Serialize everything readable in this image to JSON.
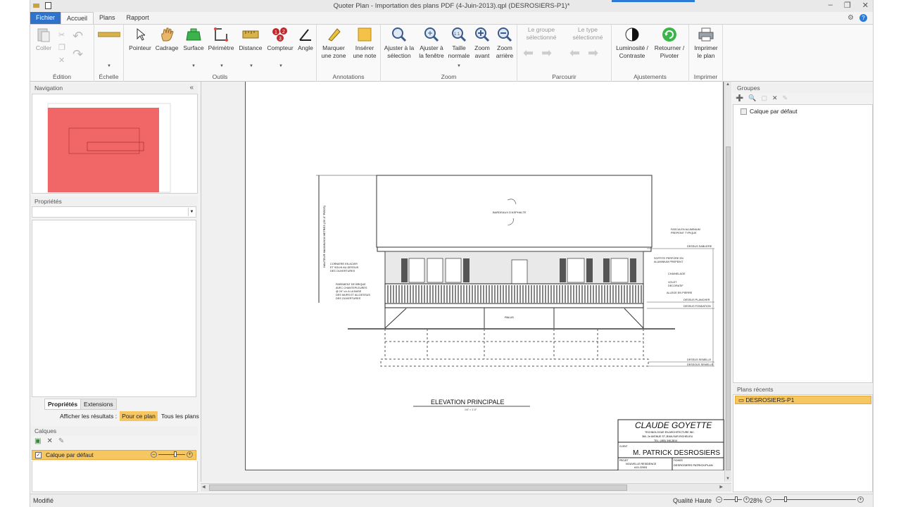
{
  "window": {
    "title": "Quoter Plan - Importation des plans PDF (4-Juin-2013).qpl (DESROSIERS-P1)*",
    "tabs": [
      "Fichier",
      "Accueil",
      "Plans",
      "Rapport"
    ]
  },
  "ribbon": {
    "edition": {
      "label": "Édition",
      "paste": "Coller"
    },
    "echelle": {
      "label": "Échelle"
    },
    "outils": {
      "label": "Outils",
      "buttons": [
        "Pointeur",
        "Cadrage",
        "Surface",
        "Périmètre",
        "Distance",
        "Compteur",
        "Angle"
      ]
    },
    "annotations": {
      "label": "Annotations",
      "mark_l1": "Marquer",
      "mark_l2": "une zone",
      "note_l1": "Insérer",
      "note_l2": "une note"
    },
    "zoom": {
      "label": "Zoom",
      "fit_sel_l1": "Ajuster à la",
      "fit_sel_l2": "sélection",
      "fit_win_l1": "Ajuster à",
      "fit_win_l2": "la fenêtre",
      "normal_l1": "Taille",
      "normal_l2": "normale",
      "in_l1": "Zoom",
      "in_l2": "avant",
      "out_l1": "Zoom",
      "out_l2": "arrière"
    },
    "parcourir": {
      "label": "Parcourir",
      "group_l1": "Le groupe",
      "group_l2": "sélectionné",
      "type_l1": "Le type",
      "type_l2": "sélectionné"
    },
    "ajustements": {
      "label": "Ajustements",
      "lum_l1": "Luminosité /",
      "lum_l2": "Contraste",
      "rot_l1": "Retourner /",
      "rot_l2": "Pivoter"
    },
    "imprimer": {
      "label": "Imprimer",
      "btn_l1": "Imprimer",
      "btn_l2": "le plan"
    }
  },
  "navigation": {
    "title": "Navigation",
    "collapse": "«"
  },
  "properties": {
    "title": "Propriétés",
    "tab_props": "Propriétés",
    "tab_ext": "Extensions",
    "show_results": "Afficher les résultats :",
    "for_plan": "Pour ce plan",
    "all_plans": "Tous les plans"
  },
  "layers": {
    "title": "Calques",
    "default_layer": "Calque par défaut"
  },
  "groups": {
    "title": "Groupes",
    "default_layer": "Calque par défaut"
  },
  "recent": {
    "title": "Plans récents",
    "item": "DESROSIERS-P1"
  },
  "drawing": {
    "elevation_title": "ELEVATION  PRINCIPALE",
    "scale_note": "1/4\" = 1'-0\"",
    "roof_note": "BARDEAUX D'ASPHALTE",
    "left_notes": [
      "CORNIERE EN ACIER",
      "ET SOLIN AU-DESSUS",
      "DES OUVERTURES",
      "PAREMENT DE BRIQUE",
      "AVEC CHANTEPLEURES",
      "@ 24\" c/c A LA BASE",
      "DES MURS ET AU-DESSUS",
      "DES OUVERTURES"
    ],
    "right_notes": [
      "FASCIA EN ALUMINIUM",
      "PREPEINT TYPIQUE",
      "SOFFITE PERFORE EN",
      "ALUMINIUM PREPEINT",
      "CHAINELAGE",
      "VOLET",
      "DECORATIF",
      "ALLEGE EN PIERRE"
    ],
    "levels": [
      "DESSUS SABLIERE",
      "DESSUS PLANCHER",
      "DESSUS FONDATION",
      "DESSUS SEMELLE",
      "DESSOUS SEMELLE"
    ],
    "grade_note": "PALUS",
    "dim_note": "HAUTEUR MAXIMUM 8 METRES (26'-3\" PIEDS)",
    "titleblock": {
      "company": "CLAUDE GOYETTE",
      "company_sub1": "TECHNOLOGUE EN ARCHITECTURE INC.",
      "company_sub2": "360, 2e AVENUE ST-JEAN-SUR-RICHELIEU",
      "company_sub3": "TEL: (450) 346-3814",
      "client_label": "CLIENT",
      "client": "M. PATRICK DESROSIERS",
      "project_label": "PROJET",
      "project1": "NOUVELLE RESIDENCE",
      "project2": "#13-22003",
      "dwg_label": "FICHIER",
      "dwg": "DESROSIERS PATRICK/PLAN"
    }
  },
  "status": {
    "left": "Modifié",
    "quality": "Qualité Haute",
    "zoom": "28%"
  },
  "colors": {
    "file_tab": "#2e73c9",
    "selection": "#f6c660",
    "nav_overlay": "#ee4b4b"
  }
}
